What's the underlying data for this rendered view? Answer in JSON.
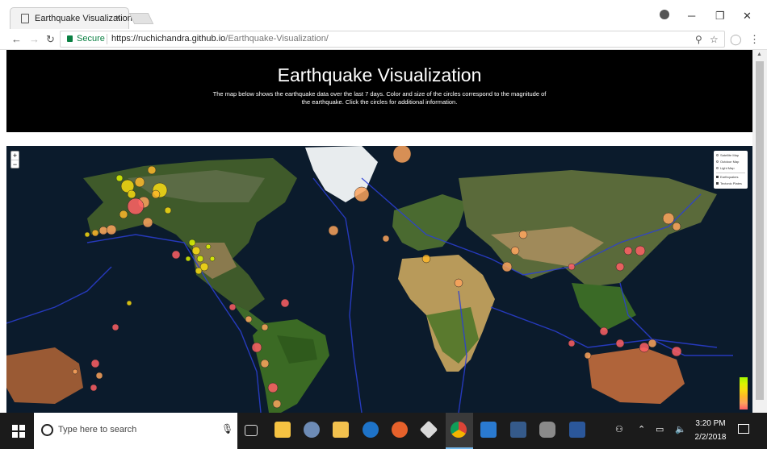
{
  "browser": {
    "tab_title": "Earthquake Visualization",
    "tab_close": "×",
    "secure_label": "Secure",
    "url_base": "https://ruchichandra.github.io",
    "url_path": "/Earthquake-Visualization/"
  },
  "page": {
    "title": "Earthquake Visualization",
    "description": "The map below shows the earthquake data over the last 7 days. Color and size of the circles correspond to the magnitude of the earthquake. Click the circles for additional information."
  },
  "map": {
    "zoom_in": "+",
    "zoom_out": "−",
    "base_layers": [
      "Satellite Map",
      "Outdoor Map",
      "Light Map"
    ],
    "overlays": [
      "Earthquakes",
      "Tectonic Plates"
    ],
    "legend_colors": [
      "#a3f600",
      "#dcf400",
      "#f7db11",
      "#fdb72a",
      "#fca35d",
      "#ff5f65"
    ]
  },
  "taskbar": {
    "search_placeholder": "Type here to search",
    "time": "3:20 PM",
    "date": "2/2/2018"
  }
}
